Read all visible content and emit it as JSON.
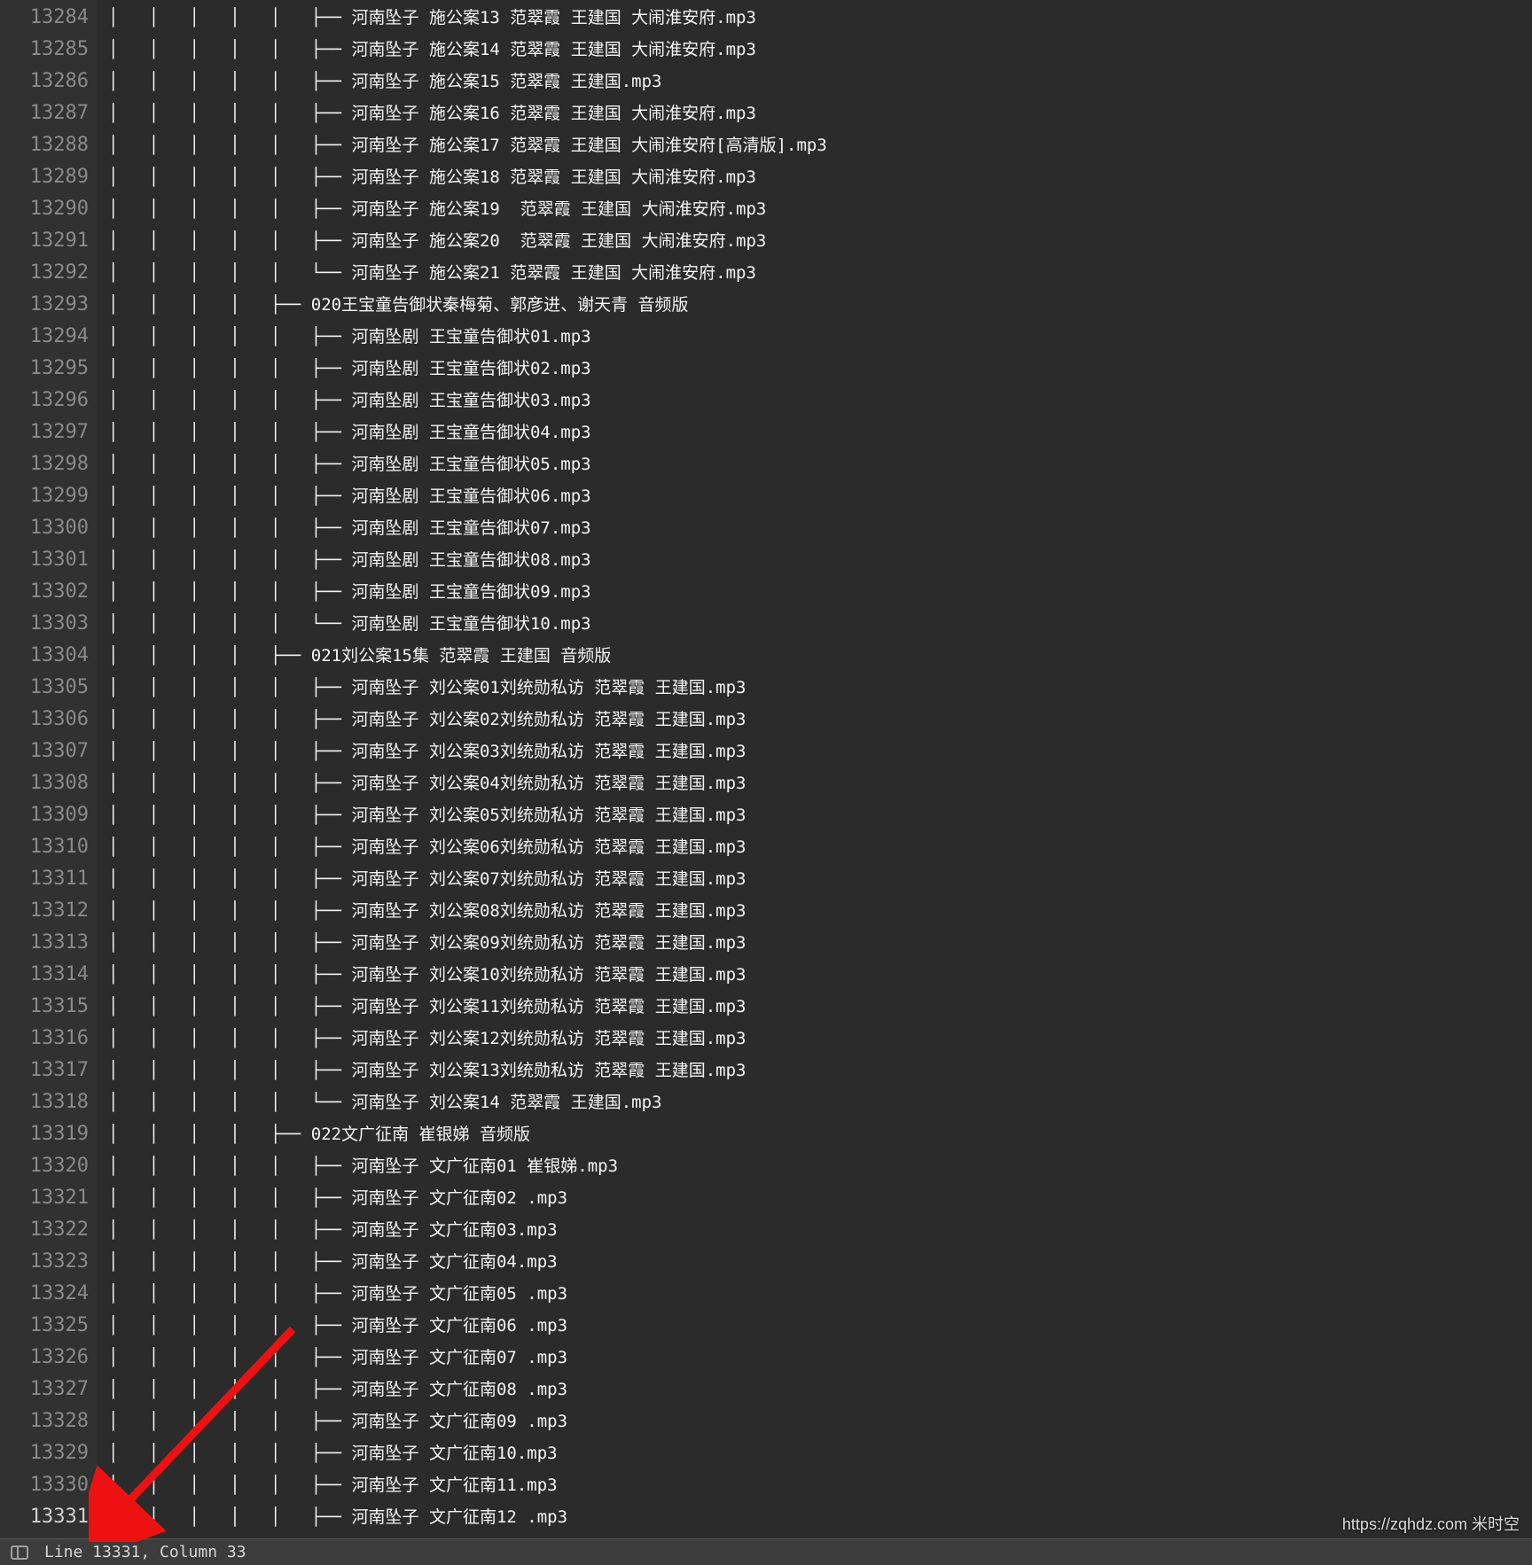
{
  "first_line_number": 13284,
  "active_line_number": 13331,
  "status": {
    "text": "Line 13331, Column 33"
  },
  "watermark": "https://zqhdz.com 米时空",
  "rows": [
    {
      "indent": 5,
      "branch": "mid",
      "text": "河南坠子 施公案13 范翠霞 王建国 大闹淮安府.mp3"
    },
    {
      "indent": 5,
      "branch": "mid",
      "text": "河南坠子 施公案14 范翠霞 王建国 大闹淮安府.mp3"
    },
    {
      "indent": 5,
      "branch": "mid",
      "text": "河南坠子 施公案15 范翠霞 王建国.mp3"
    },
    {
      "indent": 5,
      "branch": "mid",
      "text": "河南坠子 施公案16 范翠霞 王建国 大闹淮安府.mp3"
    },
    {
      "indent": 5,
      "branch": "mid",
      "text": "河南坠子 施公案17 范翠霞 王建国 大闹淮安府[高清版].mp3"
    },
    {
      "indent": 5,
      "branch": "mid",
      "text": "河南坠子 施公案18 范翠霞 王建国 大闹淮安府.mp3"
    },
    {
      "indent": 5,
      "branch": "mid",
      "text": "河南坠子 施公案19  范翠霞 王建国 大闹淮安府.mp3"
    },
    {
      "indent": 5,
      "branch": "mid",
      "text": "河南坠子 施公案20  范翠霞 王建国 大闹淮安府.mp3"
    },
    {
      "indent": 5,
      "branch": "end",
      "text": "河南坠子 施公案21 范翠霞 王建国 大闹淮安府.mp3"
    },
    {
      "indent": 4,
      "branch": "mid",
      "text": "020王宝童告御状秦梅菊、郭彦进、谢天青 音频版"
    },
    {
      "indent": 5,
      "branch": "mid",
      "text": "河南坠剧 王宝童告御状01.mp3"
    },
    {
      "indent": 5,
      "branch": "mid",
      "text": "河南坠剧 王宝童告御状02.mp3"
    },
    {
      "indent": 5,
      "branch": "mid",
      "text": "河南坠剧 王宝童告御状03.mp3"
    },
    {
      "indent": 5,
      "branch": "mid",
      "text": "河南坠剧 王宝童告御状04.mp3"
    },
    {
      "indent": 5,
      "branch": "mid",
      "text": "河南坠剧 王宝童告御状05.mp3"
    },
    {
      "indent": 5,
      "branch": "mid",
      "text": "河南坠剧 王宝童告御状06.mp3"
    },
    {
      "indent": 5,
      "branch": "mid",
      "text": "河南坠剧 王宝童告御状07.mp3"
    },
    {
      "indent": 5,
      "branch": "mid",
      "text": "河南坠剧 王宝童告御状08.mp3"
    },
    {
      "indent": 5,
      "branch": "mid",
      "text": "河南坠剧 王宝童告御状09.mp3"
    },
    {
      "indent": 5,
      "branch": "end",
      "text": "河南坠剧 王宝童告御状10.mp3"
    },
    {
      "indent": 4,
      "branch": "mid",
      "text": "021刘公案15集 范翠霞 王建国 音频版"
    },
    {
      "indent": 5,
      "branch": "mid",
      "text": "河南坠子 刘公案01刘统勋私访 范翠霞 王建国.mp3"
    },
    {
      "indent": 5,
      "branch": "mid",
      "text": "河南坠子 刘公案02刘统勋私访 范翠霞 王建国.mp3"
    },
    {
      "indent": 5,
      "branch": "mid",
      "text": "河南坠子 刘公案03刘统勋私访 范翠霞 王建国.mp3"
    },
    {
      "indent": 5,
      "branch": "mid",
      "text": "河南坠子 刘公案04刘统勋私访 范翠霞 王建国.mp3"
    },
    {
      "indent": 5,
      "branch": "mid",
      "text": "河南坠子 刘公案05刘统勋私访 范翠霞 王建国.mp3"
    },
    {
      "indent": 5,
      "branch": "mid",
      "text": "河南坠子 刘公案06刘统勋私访 范翠霞 王建国.mp3"
    },
    {
      "indent": 5,
      "branch": "mid",
      "text": "河南坠子 刘公案07刘统勋私访 范翠霞 王建国.mp3"
    },
    {
      "indent": 5,
      "branch": "mid",
      "text": "河南坠子 刘公案08刘统勋私访 范翠霞 王建国.mp3"
    },
    {
      "indent": 5,
      "branch": "mid",
      "text": "河南坠子 刘公案09刘统勋私访 范翠霞 王建国.mp3"
    },
    {
      "indent": 5,
      "branch": "mid",
      "text": "河南坠子 刘公案10刘统勋私访 范翠霞 王建国.mp3"
    },
    {
      "indent": 5,
      "branch": "mid",
      "text": "河南坠子 刘公案11刘统勋私访 范翠霞 王建国.mp3"
    },
    {
      "indent": 5,
      "branch": "mid",
      "text": "河南坠子 刘公案12刘统勋私访 范翠霞 王建国.mp3"
    },
    {
      "indent": 5,
      "branch": "mid",
      "text": "河南坠子 刘公案13刘统勋私访 范翠霞 王建国.mp3"
    },
    {
      "indent": 5,
      "branch": "end",
      "text": "河南坠子 刘公案14 范翠霞 王建国.mp3"
    },
    {
      "indent": 4,
      "branch": "mid",
      "text": "022文广征南 崔银娣 音频版"
    },
    {
      "indent": 5,
      "branch": "mid",
      "text": "河南坠子 文广征南01 崔银娣.mp3"
    },
    {
      "indent": 5,
      "branch": "mid",
      "text": "河南坠子 文广征南02 .mp3"
    },
    {
      "indent": 5,
      "branch": "mid",
      "text": "河南坠子 文广征南03.mp3"
    },
    {
      "indent": 5,
      "branch": "mid",
      "text": "河南坠子 文广征南04.mp3"
    },
    {
      "indent": 5,
      "branch": "mid",
      "text": "河南坠子 文广征南05 .mp3"
    },
    {
      "indent": 5,
      "branch": "mid",
      "text": "河南坠子 文广征南06 .mp3"
    },
    {
      "indent": 5,
      "branch": "mid",
      "text": "河南坠子 文广征南07 .mp3"
    },
    {
      "indent": 5,
      "branch": "mid",
      "text": "河南坠子 文广征南08 .mp3"
    },
    {
      "indent": 5,
      "branch": "mid",
      "text": "河南坠子 文广征南09 .mp3"
    },
    {
      "indent": 5,
      "branch": "mid",
      "text": "河南坠子 文广征南10.mp3"
    },
    {
      "indent": 5,
      "branch": "mid",
      "text": "河南坠子 文广征南11.mp3"
    },
    {
      "indent": 5,
      "branch": "mid",
      "text": "河南坠子 文广征南12 .mp3"
    }
  ]
}
